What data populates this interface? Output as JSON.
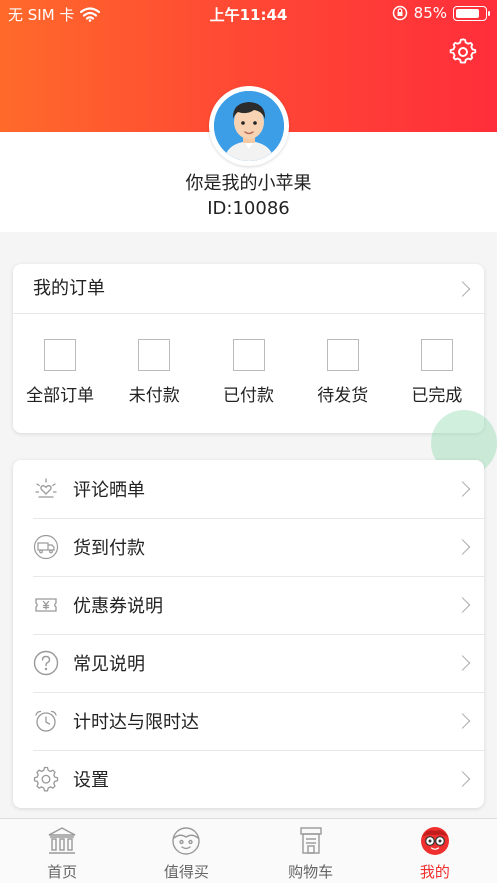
{
  "status_bar": {
    "carrier": "无 SIM 卡",
    "time": "上午11:44",
    "battery_text": "85%",
    "battery_level": 0.85
  },
  "profile": {
    "nickname": "你是我的小苹果",
    "user_id": "ID:10086"
  },
  "orders": {
    "title": "我的订单",
    "items": [
      {
        "label": "全部订单",
        "icon": "order-placeholder-icon"
      },
      {
        "label": "未付款",
        "icon": "order-placeholder-icon"
      },
      {
        "label": "已付款",
        "icon": "order-placeholder-icon"
      },
      {
        "label": "待发货",
        "icon": "order-placeholder-icon"
      },
      {
        "label": "已完成",
        "icon": "order-placeholder-icon"
      }
    ]
  },
  "menu": {
    "items": [
      {
        "label": "评论晒单",
        "icon": "sun-heart-icon"
      },
      {
        "label": "货到付款",
        "icon": "truck-icon"
      },
      {
        "label": "优惠券说明",
        "icon": "coupon-icon"
      },
      {
        "label": "常见说明",
        "icon": "question-icon"
      },
      {
        "label": "计时达与限时达",
        "icon": "alarm-clock-icon"
      },
      {
        "label": "设置",
        "icon": "gear-icon"
      }
    ]
  },
  "tabbar": {
    "items": [
      {
        "label": "首页",
        "icon": "bank-icon"
      },
      {
        "label": "值得买",
        "icon": "face-icon"
      },
      {
        "label": "购物车",
        "icon": "cart-board-icon"
      },
      {
        "label": "我的",
        "icon": "glasses-face-icon",
        "active": true
      }
    ]
  },
  "colors": {
    "header_gradient_start": "#ff6a2a",
    "header_gradient_end": "#ff2e3a",
    "active_tab": "#f0302f"
  }
}
